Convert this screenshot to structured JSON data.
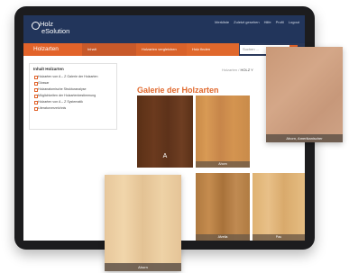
{
  "header": {
    "logo_line1": "Holz",
    "logo_line2": "eSolution",
    "nav": [
      "Merkliste",
      "Zuletzt gesehen",
      "Hilfe",
      "Profil",
      "Logout"
    ]
  },
  "subbar": {
    "brand": "Holzarten",
    "tabs": [
      "Inhalt",
      "Holzarten vergleichen",
      "Holz finden"
    ],
    "search_placeholder": "Suchen ..."
  },
  "sidebar": {
    "title": "Inhalt Holzarten",
    "items": [
      "Holzarten von A – Z Galerie der Holzarten",
      "Glossar",
      "Holzanatomische Strukturanalyse",
      "Möglichkeiten der Holzartenbestimmung",
      "Holzarten von A – Z Systematik",
      "Literaturverzeichnis"
    ]
  },
  "breadcrumb": {
    "prefix": "Holzarten",
    "current": "HOLZ Y"
  },
  "page_title": "Galerie der Holzarten",
  "tiles": [
    {
      "letter": "A",
      "caption": ""
    },
    {
      "caption": "Ahorn"
    },
    {
      "caption": "Afzelia"
    },
    {
      "caption": "Pau"
    }
  ],
  "floating": [
    {
      "caption": "Ahorn, Amerikanischer"
    },
    {
      "caption": "Ahorn"
    }
  ],
  "colors": {
    "navy": "#22355b",
    "orange": "#e2632a",
    "heading": "#e0682c"
  }
}
